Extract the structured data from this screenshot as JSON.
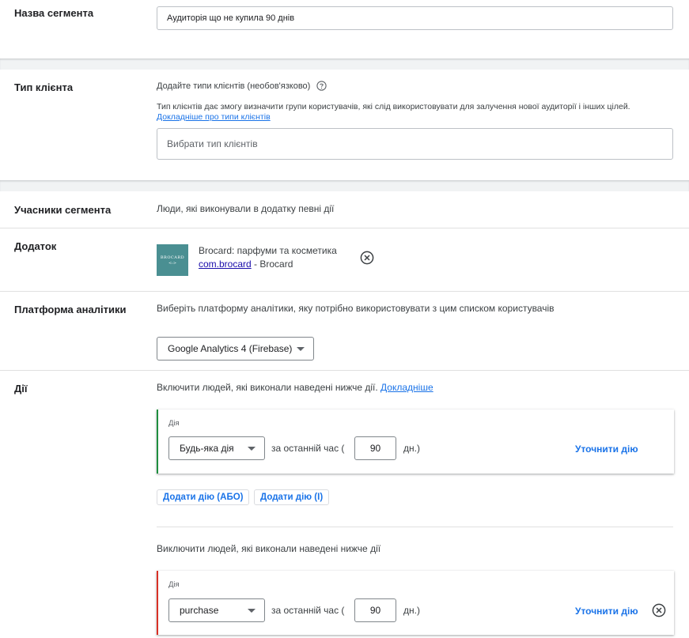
{
  "segment_name": {
    "label": "Назва сегмента",
    "value": "Аудиторія що не купила 90 днів"
  },
  "customer_type": {
    "label": "Тип клієнта",
    "heading": "Додайте типи клієнтів (необов'язково)",
    "description": "Тип клієнтів дає змогу визначити групи користувачів, які слід використовувати для залучення нової аудиторії і інших цілей.",
    "learn_more": "Докладніше про типи клієнтів",
    "placeholder": "Вибрати тип клієнтів"
  },
  "members": {
    "label": "Учасники сегмента",
    "value": "Люди, які виконували в додатку певні дії"
  },
  "app": {
    "label": "Додаток",
    "name": "Brocard: парфуми та косметика",
    "package": "com.brocard",
    "developer_suffix": " - Brocard",
    "logo_text": "BROCARD",
    "logo_mark": "<:>"
  },
  "analytics": {
    "label": "Платформа аналітики",
    "description": "Виберіть платформу аналітики, яку потрібно використовувати з цим списком користувачів",
    "selected": "Google Analytics 4 (Firebase)"
  },
  "actions": {
    "label": "Дії",
    "include_text": "Включити людей, які виконали наведені нижче дії.",
    "include_link": "Докладніше",
    "include_rule": {
      "field_label": "Дія",
      "action": "Будь-яка дія",
      "prefix": "за останній час (",
      "days": "90",
      "suffix": "дн.)",
      "refine": "Уточнити дію"
    },
    "add_or": "Додати дію (АБО)",
    "add_and": "Додати дію (І)",
    "exclude_text": "Виключити людей, які виконали наведені нижче дії",
    "exclude_rule": {
      "field_label": "Дія",
      "action": "purchase",
      "prefix": "за останній час (",
      "days": "90",
      "suffix": "дн.)",
      "refine": "Уточнити дію"
    }
  },
  "colors": {
    "accent": "#1a73e8",
    "include_border": "#1e8e3e",
    "exclude_border": "#d93025",
    "logo_bg": "#4a8f92"
  }
}
